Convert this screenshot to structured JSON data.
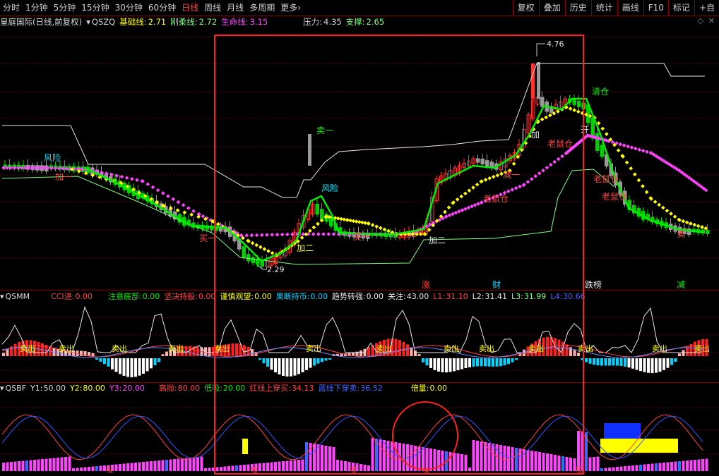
{
  "toolbar": {
    "timeframes": [
      "分时",
      "1分钟",
      "5分钟",
      "15分钟",
      "30分钟",
      "60分钟",
      "日线",
      "周线",
      "月线",
      "多周期",
      "更多"
    ],
    "active": "日线",
    "right": [
      "复权",
      "叠加",
      "历史",
      "统计",
      "画线",
      "F10",
      "标记",
      "+自"
    ]
  },
  "main": {
    "stock_name": "皇庭国际(日线,前复权)",
    "indicator": "QSZQ",
    "jichu_label": "基础线:",
    "jichu_value": "2.71",
    "gangrou_label": "刚柔线:",
    "gangrou_value": "2.72",
    "shengming_label": "生命线:",
    "shengming_value": "3.15",
    "yali_label": "压力:",
    "yali_value": "4.35",
    "zhicheng_label": "支撑:",
    "zhicheng_value": "2.65",
    "high_label": "4.76",
    "low_label": "2.29",
    "annotations": {
      "fengxian1": "风险",
      "jiayi": "加一",
      "maiyi_top": "卖一",
      "fengxian2": "风险",
      "jiaer1": "加二",
      "jiaer2": "加二",
      "maiyi1": "买一",
      "maiyi2": "买一",
      "qingcang": "清仓",
      "laoshucang1": "老鼠仓",
      "laoshucang2": "老鼠仓",
      "laoshucang3": "老鼠仓",
      "laoshucang4": "老鼠仓",
      "jia": "加",
      "kai": "开",
      "mai": "卖",
      "jianyi": "减一"
    },
    "bottom_markers": [
      "涨",
      "财",
      "跌榜",
      "减"
    ]
  },
  "qsmm": {
    "name": "QSMM",
    "cci_label": "CCI进:",
    "cci_value": "0.00",
    "zhuyi_label": "注意底部:",
    "zhuyi_value": "0.00",
    "jianjue_label": "坚决持股:",
    "jianjue_value": "0.00",
    "jinshen_label": "谨慎观望:",
    "jinshen_value": "0.00",
    "guoduan_label": "果断持币:",
    "guoduan_value": "0.00",
    "qushi_label": "趋势转强:",
    "qushi_value": "0.00",
    "guanzhu_label": "关注:",
    "guanzhu_value": "43.00",
    "l1_label": "L1:",
    "l1_value": "31.10",
    "l2_label": "L2:",
    "l2_value": "31.41",
    "l3_label": "L3:",
    "l3_value": "31.99",
    "l4_label": "L4:",
    "l4_value": "30.66",
    "sell_label": "卖出"
  },
  "qsbf": {
    "name": "QSBF",
    "y1_label": "Y1:",
    "y1_value": "50.00",
    "y2_label": "Y2:",
    "y2_value": "80.00",
    "y3_label": "Y3:",
    "y3_value": "20.00",
    "gaopao_label": "高抛:",
    "gaopao_value": "80.00",
    "dixi_label": "低吸:",
    "dixi_value": "20.00",
    "hongxian_label": "红线上穿买:",
    "hongxian_value": "34.13",
    "lanxian_label": "蓝线下穿卖:",
    "lanxian_value": "36.52",
    "beiliang_label": "倍量:",
    "beiliang_value": "0.00",
    "bottom_marks": [
      "吸",
      "吸",
      "吸",
      "吸",
      "吸"
    ]
  },
  "colors": {
    "up": "#ff3232",
    "down": "#00d200",
    "accent": "#ff4444",
    "grid": "#8a0000",
    "magenta": "#ff44ff",
    "yellow": "#ffff00",
    "cyan": "#00d4ff"
  }
}
